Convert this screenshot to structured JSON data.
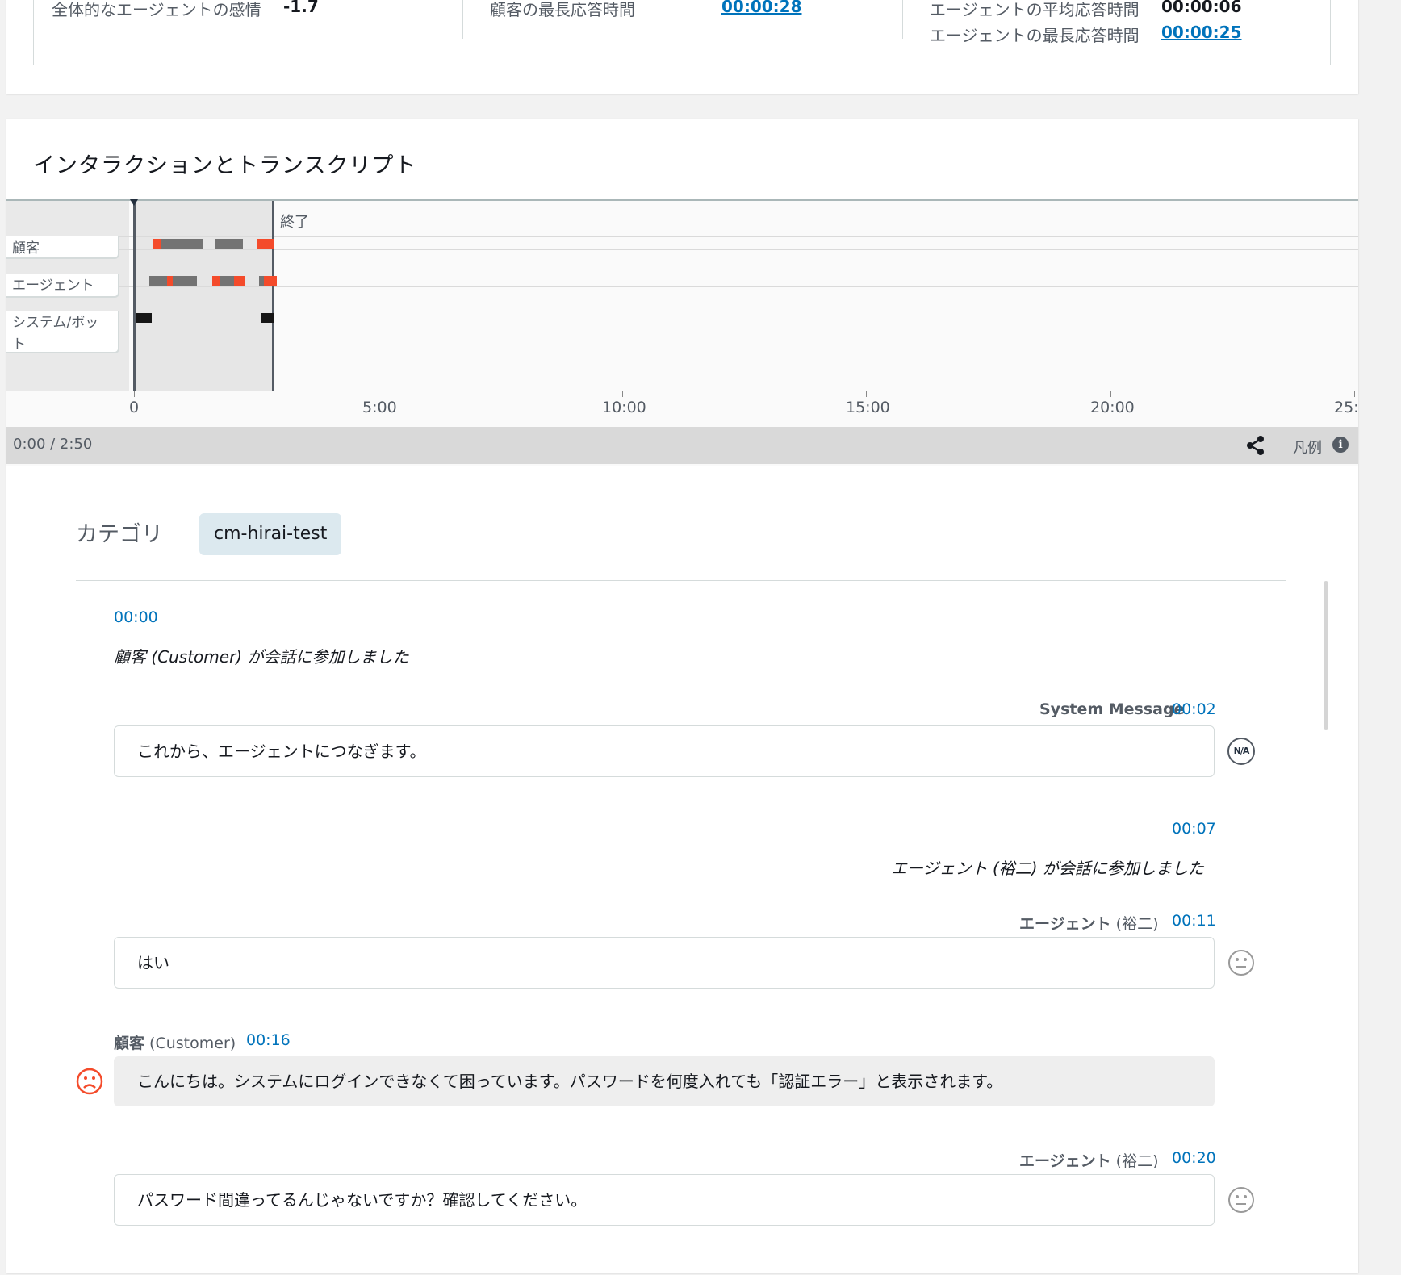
{
  "metrics": {
    "overall_agent_sentiment_label": "全体的なエージェントの感情",
    "overall_agent_sentiment_value": "-1.7",
    "customer_max_response_label": "顧客の最長応答時間",
    "customer_max_response_value": "00:00:28",
    "agent_avg_response_label": "エージェントの平均応答時間",
    "agent_avg_response_value": "00:00:06",
    "agent_max_response_label": "エージェントの最長応答時間",
    "agent_max_response_value": "00:00:25"
  },
  "section": {
    "title": "インタラクションとトランスクリプト"
  },
  "timeline": {
    "end_label": "終了",
    "tracks": [
      "顧客",
      "エージェント",
      "システム/ボット"
    ],
    "axis_ticks": [
      "0",
      "5:00",
      "10:00",
      "15:00",
      "20:00",
      "25:"
    ],
    "playback_time": "0:00 / 2:50",
    "legend_label": "凡例",
    "info_icon_text": "i",
    "colors": {
      "speech": "#737373",
      "negative": "#f44b2b",
      "system": "#161616"
    }
  },
  "category": {
    "label": "カテゴリ",
    "chip": "cm-hirai-test"
  },
  "transcript": {
    "items": [
      {
        "type": "event",
        "time": "00:00",
        "text": "顧客 (Customer) が会話に参加しました"
      },
      {
        "type": "message",
        "speaker": "System Message",
        "time": "00:02",
        "text": "これから、エージェントにつなぎます。",
        "sentiment": "N/A"
      },
      {
        "type": "event",
        "time": "00:07",
        "text": "エージェント (裕二) が会話に参加しました"
      },
      {
        "type": "message",
        "speaker_main": "エージェント",
        "speaker_sub": " (裕二)",
        "time": "00:11",
        "text": "はい",
        "sentiment": "neutral"
      },
      {
        "type": "message",
        "speaker_main": "顧客",
        "speaker_sub": " (Customer)",
        "time": "00:16",
        "text": "こんにちは。システムにログインできなくて困っています。パスワードを何度入れても「認証エラー」と表示されます。",
        "sentiment": "negative"
      },
      {
        "type": "message",
        "speaker_main": "エージェント",
        "speaker_sub": " (裕二)",
        "time": "00:20",
        "text": "パスワード間違ってるんじゃないですか？確認してください。",
        "sentiment": "neutral"
      }
    ]
  }
}
